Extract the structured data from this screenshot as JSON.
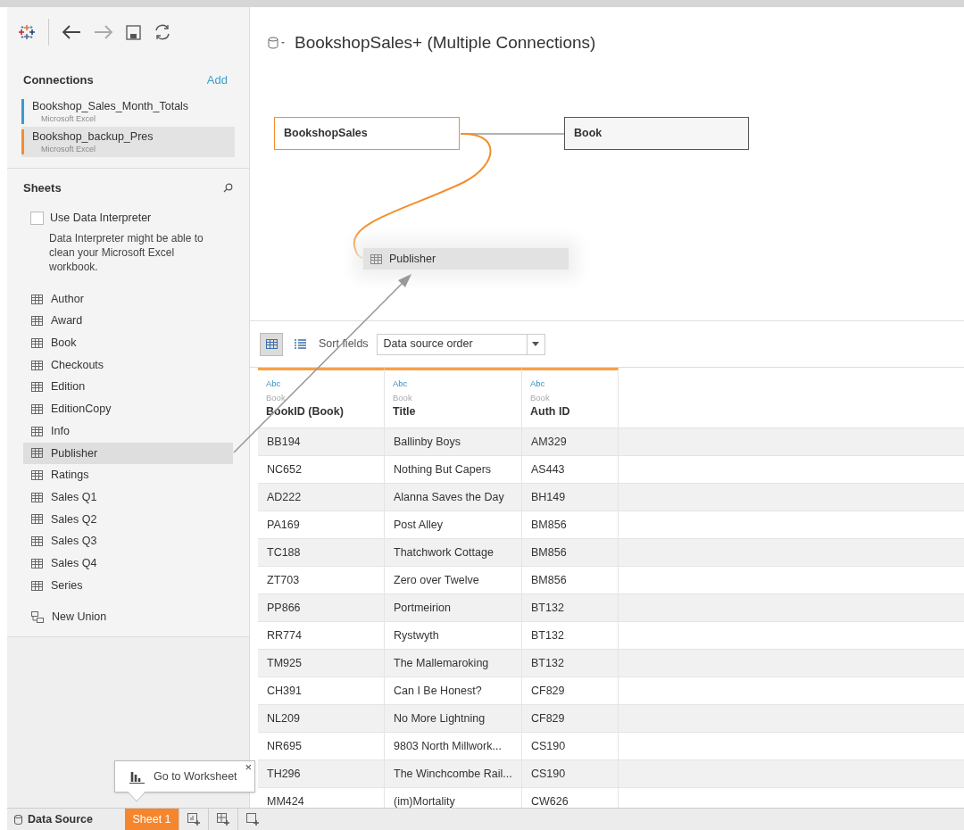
{
  "connections": {
    "title": "Connections",
    "add": "Add",
    "items": [
      {
        "name": "Bookshop_Sales_Month_Totals",
        "type": "Microsoft Excel",
        "color": "#3a9bd0",
        "selected": false
      },
      {
        "name": "Bookshop_backup_Pres",
        "type": "Microsoft Excel",
        "color": "#f28e2b",
        "selected": true
      }
    ]
  },
  "sheets": {
    "title": "Sheets",
    "interpreter": {
      "label": "Use Data Interpreter",
      "checked": false
    },
    "interpreter_note": "Data Interpreter might be able to clean your Microsoft Excel workbook.",
    "items": [
      {
        "name": "Author",
        "selected": false
      },
      {
        "name": "Award",
        "selected": false
      },
      {
        "name": "Book",
        "selected": false
      },
      {
        "name": "Checkouts",
        "selected": false
      },
      {
        "name": "Edition",
        "selected": false
      },
      {
        "name": "EditionCopy",
        "selected": false
      },
      {
        "name": "Info",
        "selected": false
      },
      {
        "name": "Publisher",
        "selected": true
      },
      {
        "name": "Ratings",
        "selected": false
      },
      {
        "name": "Sales Q1",
        "selected": false
      },
      {
        "name": "Sales Q2",
        "selected": false
      },
      {
        "name": "Sales Q3",
        "selected": false
      },
      {
        "name": "Sales Q4",
        "selected": false
      },
      {
        "name": "Series",
        "selected": false
      }
    ],
    "new_union": "New Union"
  },
  "data_source": {
    "title": "BookshopSales+ (Multiple Connections)"
  },
  "canvas": {
    "tables": [
      {
        "name": "BookshopSales",
        "kind": "main"
      },
      {
        "name": "Book",
        "kind": "joined"
      },
      {
        "name": "Publisher",
        "kind": "dragging"
      }
    ]
  },
  "grid": {
    "views": [
      {
        "kind": "grid",
        "selected": true
      },
      {
        "kind": "list",
        "selected": false
      }
    ],
    "sort_label": "Sort fields",
    "sort_value": "Data source order",
    "columns": [
      {
        "type": "Abc",
        "source": "Book",
        "name": "BookID (Book)"
      },
      {
        "type": "Abc",
        "source": "Book",
        "name": "Title"
      },
      {
        "type": "Abc",
        "source": "Book",
        "name": "Auth ID"
      }
    ],
    "rows": [
      [
        "BB194",
        "Ballinby Boys",
        "AM329"
      ],
      [
        "NC652",
        "Nothing But Capers",
        "AS443"
      ],
      [
        "AD222",
        "Alanna Saves the Day",
        "BH149"
      ],
      [
        "PA169",
        "Post Alley",
        "BM856"
      ],
      [
        "TC188",
        "Thatchwork Cottage",
        "BM856"
      ],
      [
        "ZT703",
        "Zero over Twelve",
        "BM856"
      ],
      [
        "PP866",
        "Portmeirion",
        "BT132"
      ],
      [
        "RR774",
        "Rystwyth",
        "BT132"
      ],
      [
        "TM925",
        "The Mallemaroking",
        "BT132"
      ],
      [
        "CH391",
        "Can I Be Honest?",
        "CF829"
      ],
      [
        "NL209",
        "No More Lightning",
        "CF829"
      ],
      [
        "NR695",
        "9803 North Millwork...",
        "CS190"
      ],
      [
        "TH296",
        "The Winchcombe Rail...",
        "CS190"
      ],
      [
        "MM424",
        "(im)Mortality",
        "CW626"
      ]
    ]
  },
  "bottom": {
    "data_source": "Data Source",
    "sheets": [
      {
        "label": "Sheet 1",
        "selected": true
      }
    ],
    "tooltip": "Go to Worksheet",
    "tooltip_close": "×"
  }
}
